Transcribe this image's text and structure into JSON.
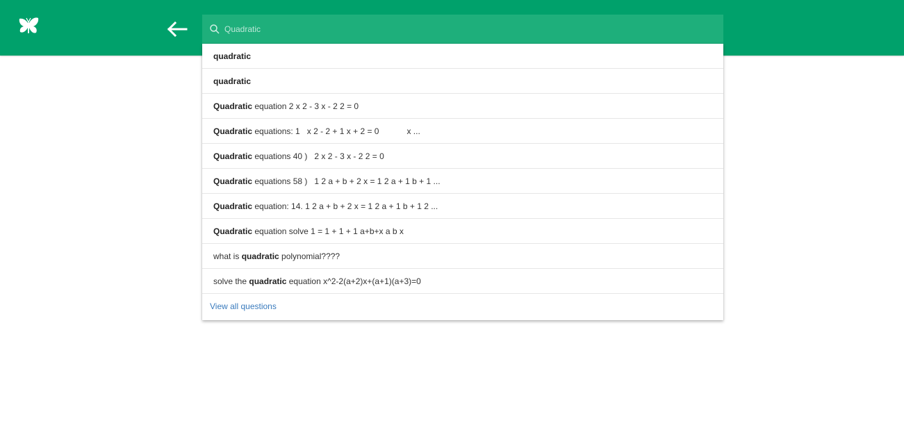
{
  "header": {
    "logo_icon": "butterfly-icon",
    "back_icon": "arrow-left-icon",
    "background_color": "#00a16b"
  },
  "search": {
    "icon": "search-icon",
    "value": "",
    "placeholder": "Quadratic"
  },
  "suggestions": [
    {
      "pre": "",
      "bold": "quadratic",
      "post": ""
    },
    {
      "pre": "",
      "bold": "quadratic",
      "post": ""
    },
    {
      "pre": "",
      "bold": "Quadratic",
      "post": " equation 2 x 2 - 3 x - 2 2 = 0"
    },
    {
      "pre": "",
      "bold": "Quadratic",
      "post": " equations: 1   x 2 - 2 + 1 x + 2 = 0            x ..."
    },
    {
      "pre": "",
      "bold": "Quadratic",
      "post": " equations 40 )   2 x 2 - 3 x - 2 2 = 0"
    },
    {
      "pre": "",
      "bold": "Quadratic",
      "post": " equations 58 )   1 2 a + b + 2 x = 1 2 a + 1 b + 1 ..."
    },
    {
      "pre": "",
      "bold": "Quadratic",
      "post": " equation: 14. 1 2 a + b + 2 x = 1 2 a + 1 b + 1 2 ..."
    },
    {
      "pre": "",
      "bold": "Quadratic",
      "post": " equation solve 1 = 1 + 1 + 1 a+b+x a b x"
    },
    {
      "pre": "what is ",
      "bold": "quadratic",
      "post": " polynomial????"
    },
    {
      "pre": "solve the ",
      "bold": "quadratic",
      "post": " equation x^2-2(a+2)x+(a+1)(a+3)=0"
    }
  ],
  "view_all_label": "View all questions"
}
